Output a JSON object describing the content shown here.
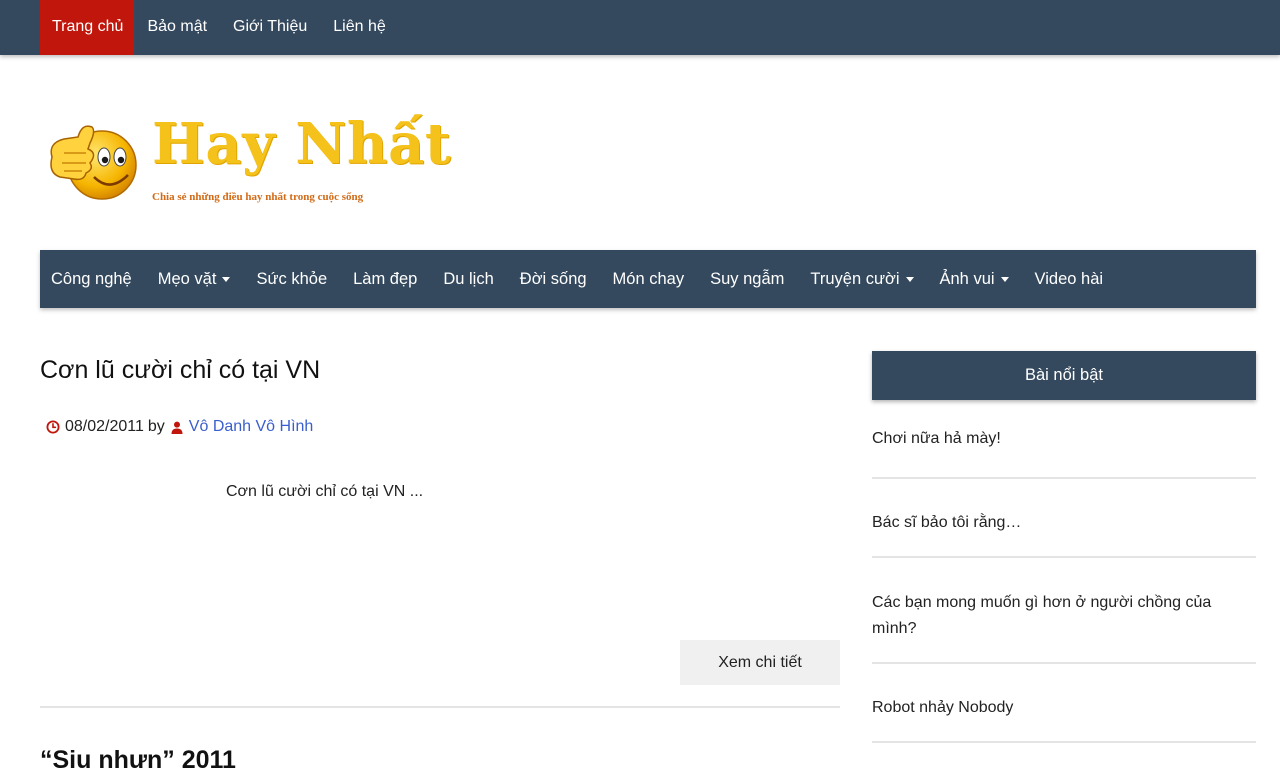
{
  "topnav": {
    "items": [
      {
        "label": "Trang chủ",
        "active": true
      },
      {
        "label": "Bảo mật",
        "active": false
      },
      {
        "label": "Giới Thiệu",
        "active": false
      },
      {
        "label": "Liên hệ",
        "active": false
      }
    ]
  },
  "logo": {
    "title": "Hay Nhất",
    "tagline": "Chia sẻ những điều hay nhất trong cuộc sống",
    "icon": "thumbs-up-smiley-icon"
  },
  "mainmenu": {
    "items": [
      {
        "label": "Công nghệ",
        "dropdown": false
      },
      {
        "label": "Mẹo vặt",
        "dropdown": true
      },
      {
        "label": "Sức khỏe",
        "dropdown": false
      },
      {
        "label": "Làm đẹp",
        "dropdown": false
      },
      {
        "label": "Du lịch",
        "dropdown": false
      },
      {
        "label": "Đời sống",
        "dropdown": false
      },
      {
        "label": "Món chay",
        "dropdown": false
      },
      {
        "label": "Suy ngẫm",
        "dropdown": false
      },
      {
        "label": "Truyện cười",
        "dropdown": true
      },
      {
        "label": "Ảnh vui",
        "dropdown": true
      },
      {
        "label": "Video hài",
        "dropdown": false
      }
    ]
  },
  "post": {
    "title": "Cơn lũ cười chỉ có tại VN",
    "date": "08/02/2011",
    "by": "by",
    "author": "Vô Danh Vô Hình",
    "excerpt": "Cơn lũ cười chỉ có tại VN ...",
    "read_more": "Xem chi tiết"
  },
  "post2": {
    "title": "“Siu nhưn” 2011"
  },
  "sidebar": {
    "widget_title": "Bài nổi bật",
    "items": [
      "Chơi nữa hả mày!",
      "Bác sĩ bảo tôi rằng…",
      "Các bạn mong muốn gì hơn ở người chồng của mình?",
      "Robot nhảy Nobody"
    ]
  },
  "colors": {
    "nav_bg": "#34495e",
    "active_bg": "#c0160b",
    "accent_red": "#c0160b",
    "author_link": "#3a5fcd",
    "logo_yellow": "#f4c21a"
  }
}
